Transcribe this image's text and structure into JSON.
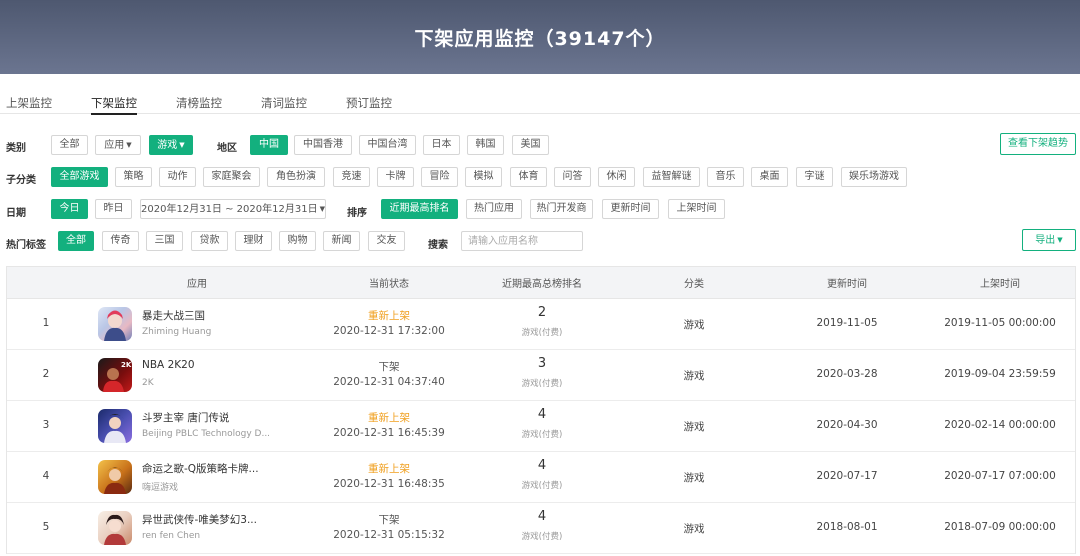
{
  "header": {
    "title": "下架应用监控（39147个）"
  },
  "tabs": [
    "上架监控",
    "下架监控",
    "清榜监控",
    "清词监控",
    "预订监控"
  ],
  "filters": {
    "category_label": "类别",
    "category": [
      "全部",
      "应用",
      "游戏"
    ],
    "region_label": "地区",
    "region": [
      "中国",
      "中国香港",
      "中国台湾",
      "日本",
      "韩国",
      "美国"
    ],
    "trend_button": "查看下架趋势",
    "subcat_label": "子分类",
    "subcat": [
      "全部游戏",
      "策略",
      "动作",
      "家庭聚会",
      "角色扮演",
      "竞速",
      "卡牌",
      "冒险",
      "模拟",
      "体育",
      "问答",
      "休闲",
      "益智解谜",
      "音乐",
      "桌面",
      "字谜",
      "娱乐场游戏"
    ],
    "date_label": "日期",
    "date": [
      "今日",
      "昨日"
    ],
    "date_range": "2020年12月31日 ~ 2020年12月31日",
    "sort_label": "排序",
    "sort": [
      "近期最高排名",
      "热门应用",
      "热门开发商",
      "更新时间",
      "上架时间"
    ],
    "hot_label": "热门标签",
    "hot": [
      "全部",
      "传奇",
      "三国",
      "贷款",
      "理财",
      "购物",
      "新闻",
      "交友"
    ],
    "search_label": "搜索",
    "search_placeholder": "请输入应用名称",
    "export_button": "导出"
  },
  "table": {
    "headers": [
      "应用",
      "当前状态",
      "近期最高总榜排名",
      "分类",
      "更新时间",
      "上架时间"
    ],
    "rows": [
      {
        "index": "1",
        "name": "暴走大战三国",
        "developer": "Zhiming Huang",
        "status": "重新上架",
        "status_type": "relisted",
        "status_time": "2020-12-31 17:32:00",
        "rank": "2",
        "rank_sub": "游戏(付费)",
        "category": "游戏",
        "updated": "2019-11-05",
        "listed": "2019-11-05 00:00:00",
        "icon": "anime-girl-icon"
      },
      {
        "index": "2",
        "name": "NBA 2K20",
        "developer": "2K",
        "status": "下架",
        "status_type": "removed",
        "status_time": "2020-12-31 04:37:40",
        "rank": "3",
        "rank_sub": "游戏(付费)",
        "category": "游戏",
        "updated": "2020-03-28",
        "listed": "2019-09-04 23:59:59",
        "icon": "nba-2k20-icon"
      },
      {
        "index": "3",
        "name": "斗罗主宰 唐门传说",
        "developer": "Beijing PBLC Technology D...",
        "status": "重新上架",
        "status_type": "relisted",
        "status_time": "2020-12-31 16:45:39",
        "rank": "4",
        "rank_sub": "游戏(付费)",
        "category": "游戏",
        "updated": "2020-04-30",
        "listed": "2020-02-14 00:00:00",
        "icon": "warrior-icon"
      },
      {
        "index": "4",
        "name": "命运之歌-Q版策略卡牌...",
        "developer": "嗨逗游戏",
        "status": "重新上架",
        "status_type": "relisted",
        "status_time": "2020-12-31 16:48:35",
        "rank": "4",
        "rank_sub": "游戏(付费)",
        "category": "游戏",
        "updated": "2020-07-17",
        "listed": "2020-07-17 07:00:00",
        "icon": "hero-icon"
      },
      {
        "index": "5",
        "name": "异世武侠传-唯美梦幻3...",
        "developer": "ren fen Chen",
        "status": "下架",
        "status_type": "removed",
        "status_time": "2020-12-31 05:15:32",
        "rank": "4",
        "rank_sub": "游戏(付费)",
        "category": "游戏",
        "updated": "2018-08-01",
        "listed": "2018-07-09 00:00:00",
        "icon": "lady-icon"
      }
    ]
  },
  "colors": {
    "accent": "#13b07e",
    "relisted": "#f0a020",
    "header_bg": "#59627a"
  }
}
